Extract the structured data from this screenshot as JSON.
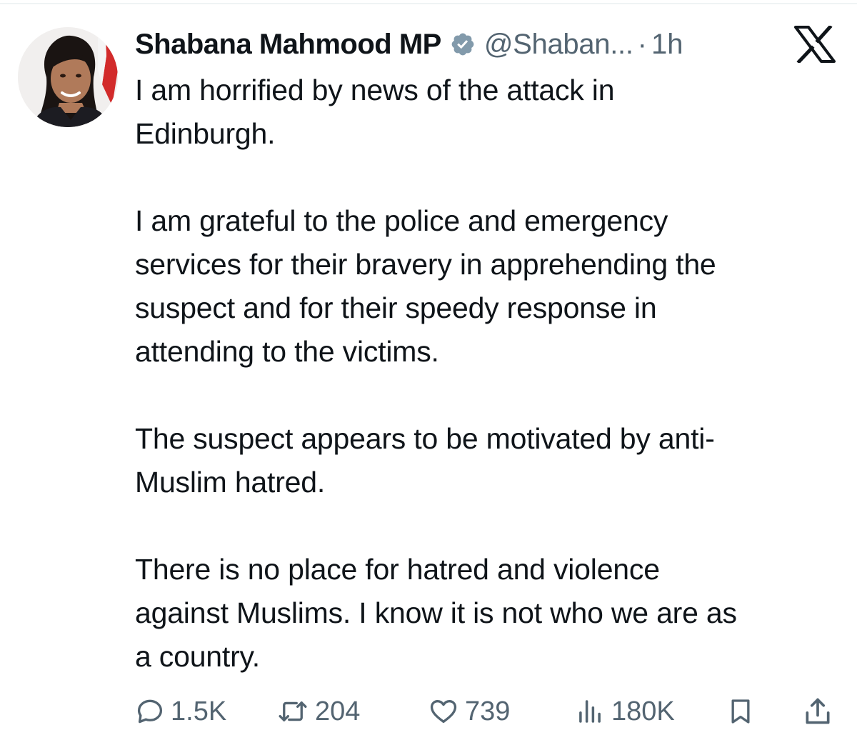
{
  "tweet": {
    "author": {
      "display_name": "Shabana Mahmood MP",
      "handle": "@Shaban...",
      "separator": "·",
      "time": "1h",
      "verified_icon": "verified-badge-icon",
      "avatar": "profile-photo"
    },
    "platform_icon": "x-logo-icon",
    "paragraphs": [
      [
        "I am horrified by news of the attack in",
        "Edinburgh."
      ],
      [
        "I am grateful to the police and emergency",
        "services for their bravery in apprehending the",
        "suspect and for their speedy response in",
        "attending to the victims."
      ],
      [
        "The suspect appears to be motivated by anti-",
        "Muslim hatred."
      ],
      [
        "There is no place for hatred and violence",
        "against Muslims. I know it is not who we are as",
        "a country."
      ]
    ],
    "actions": {
      "replies": {
        "icon": "reply-icon",
        "count": "1.5K"
      },
      "reposts": {
        "icon": "repost-icon",
        "count": "204"
      },
      "likes": {
        "icon": "heart-icon",
        "count": "739"
      },
      "views": {
        "icon": "views-icon",
        "count": "180K"
      },
      "bookmark": {
        "icon": "bookmark-icon"
      },
      "share": {
        "icon": "share-icon"
      }
    }
  },
  "colors": {
    "text_primary": "#0f1419",
    "text_secondary": "#536471",
    "verified_badge": "#829aab",
    "background": "#ffffff"
  }
}
